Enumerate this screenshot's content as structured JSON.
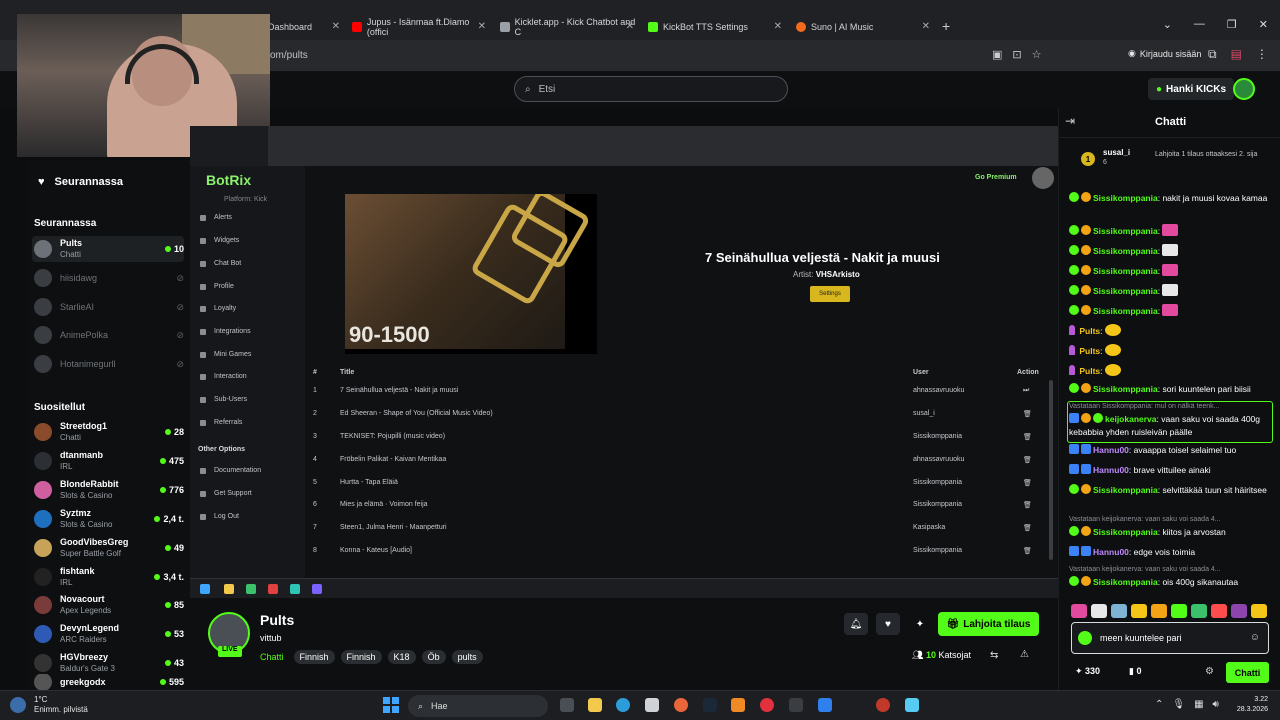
{
  "browser": {
    "tabs": [
      {
        "label": "Dashboard",
        "color": "#53fc18"
      },
      {
        "label": "Jupus - Isänmaa ft.Diamo (offici",
        "color": "#ff0000"
      },
      {
        "label": "Kicklet.app - Kick Chatbot and C",
        "color": "#9aa0a6"
      },
      {
        "label": "KickBot TTS Settings",
        "color": "#53fc18"
      },
      {
        "label": "Suno | AI Music",
        "color": "#f26b1d"
      }
    ],
    "url": "om/pults",
    "signin_label": "Kirjaudu sisään",
    "new_tab": "+"
  },
  "header": {
    "search_placeholder": "Etsi",
    "get_kicks": "Hanki KICKs"
  },
  "sidebar": {
    "following_label": "Seurannassa",
    "section_following": "Seurannassa",
    "following": [
      {
        "name": "Pults",
        "category": "Chatti",
        "count": "10",
        "live": true
      },
      {
        "name": "hiisidawg",
        "live": false
      },
      {
        "name": "StarlieAI",
        "live": false
      },
      {
        "name": "AnimePolka",
        "live": false
      },
      {
        "name": "Hotanimegurll",
        "live": false
      }
    ],
    "section_recommended": "Suositellut",
    "recommended": [
      {
        "name": "Streetdog1",
        "category": "Chatti",
        "count": "28"
      },
      {
        "name": "dtanmanb",
        "category": "IRL",
        "count": "475"
      },
      {
        "name": "BlondeRabbit",
        "category": "Slots & Casino",
        "count": "776"
      },
      {
        "name": "Syztmz",
        "category": "Slots & Casino",
        "count": "2,4 t."
      },
      {
        "name": "GoodVibesGreg",
        "category": "Super Battle Golf",
        "count": "49"
      },
      {
        "name": "fishtank",
        "category": "IRL",
        "count": "3,4 t."
      },
      {
        "name": "Novacourt",
        "category": "Apex Legends",
        "count": "85"
      },
      {
        "name": "DevynLegend",
        "category": "ARC Raiders",
        "count": "53"
      },
      {
        "name": "HGVbreezy",
        "category": "Baldur's Gate 3",
        "count": "43"
      },
      {
        "name": "greekgodx",
        "category": "",
        "count": "595"
      }
    ]
  },
  "stream": {
    "botrix": {
      "logo": "BotRix",
      "platform": "Platform: Kick",
      "nav": [
        "Alerts",
        "Widgets",
        "Chat Bot",
        "Profile",
        "Loyalty",
        "Integrations",
        "Mini Games",
        "Interaction",
        "Sub-Users",
        "Referrals"
      ],
      "other_options": "Other Options",
      "other_nav": [
        "Documentation",
        "Get Support",
        "Log Out"
      ],
      "premium": "Go Premium",
      "video_sign": "90-1500",
      "now_playing_title": "7 Seinähullua veljestä - Nakit ja muusi",
      "artist_label": "Artist:",
      "artist": "VHSArkisto",
      "settings_label": "Settings",
      "queue_headers": {
        "num": "#",
        "title": "Title",
        "user": "User",
        "action": "Action"
      },
      "queue": [
        {
          "num": "1",
          "title": "7 Seinähullua veljestä - Nakit ja muusi",
          "user": "ahnassavruuoku"
        },
        {
          "num": "2",
          "title": "Ed Sheeran - Shape of You (Official Music Video)",
          "user": "susal_i"
        },
        {
          "num": "3",
          "title": "TEKNISET: Pojupilli (music video)",
          "user": "Sissikomppania"
        },
        {
          "num": "4",
          "title": "Fröbelin Palikat - Kaivan Mentikaa",
          "user": "ahnassavruuoku"
        },
        {
          "num": "5",
          "title": "Hurtta - Tapa Eläiä",
          "user": "Sissikomppania"
        },
        {
          "num": "6",
          "title": "Mies ja elämä · Voimon feija",
          "user": "Sissikomppania"
        },
        {
          "num": "7",
          "title": "Steen1, Julma Henri - Maanpetturi",
          "user": "Kasipaska"
        },
        {
          "num": "8",
          "title": "Konna - Kateus [Audio]",
          "user": "Sissikomppania"
        }
      ]
    }
  },
  "channel": {
    "name": "Pults",
    "title": "vittub",
    "live": "LIVE",
    "category": "Chatti",
    "tags": [
      "Finnish",
      "Finnish",
      "K18",
      "Öb",
      "pults"
    ],
    "gift_sub": "Lahjoita tilaus",
    "viewers": "10",
    "viewers_label": "Katsojat"
  },
  "chat": {
    "title": "Chatti",
    "pinned": {
      "rank": "1",
      "user": "susal_i",
      "sub_count": "6",
      "text": "Lahjoita 1 tilaus ottaaksesi 2. sija"
    },
    "messages": [
      {
        "user": "Sissikomppania",
        "color": "#53fc18",
        "text": "nakit ja muusi kovaa kamaa",
        "badges": [
          "g",
          "o"
        ]
      },
      {
        "user": "Sissikomppania",
        "color": "#53fc18",
        "text": "",
        "emote": "#e24aa0",
        "badges": [
          "g",
          "o"
        ]
      },
      {
        "user": "Sissikomppania",
        "color": "#53fc18",
        "text": "",
        "emote": "#e8e8e8",
        "badges": [
          "g",
          "o"
        ]
      },
      {
        "user": "Sissikomppania",
        "color": "#53fc18",
        "text": "",
        "emote": "#e24aa0",
        "badges": [
          "g",
          "o"
        ]
      },
      {
        "user": "Sissikomppania",
        "color": "#53fc18",
        "text": "",
        "emote": "#e8e8e8",
        "badges": [
          "g",
          "o"
        ]
      },
      {
        "user": "Sissikomppania",
        "color": "#53fc18",
        "text": "",
        "emote": "#e24aa0",
        "badges": [
          "g",
          "o"
        ]
      },
      {
        "user": "Pults",
        "color": "#f5c518",
        "text": "",
        "emote": "#f5c518",
        "badges": [
          "p"
        ]
      },
      {
        "user": "Pults",
        "color": "#f5c518",
        "text": "",
        "emote": "#f5c518",
        "badges": [
          "p"
        ]
      },
      {
        "user": "Pults",
        "color": "#f5c518",
        "text": "",
        "emote": "#f5c518",
        "badges": [
          "p"
        ]
      },
      {
        "user": "Sissikomppania",
        "color": "#53fc18",
        "text": "sori kuuntelen pari biisii",
        "badges": [
          "g",
          "o"
        ]
      }
    ],
    "reply1_context": "Vastataan Sissikomppania: mul on nälkä teenk...",
    "reply1": {
      "user": "keijokanerva",
      "color": "#53fc18",
      "text": "vaan saku voi saada 400g kebabbia yhden ruisleivän päälle"
    },
    "hannu1": {
      "user": "Hannu00",
      "color": "#c08aff",
      "text": "avaappa toisel selaimel tuo"
    },
    "hannu2": {
      "user": "Hannu00",
      "color": "#c08aff",
      "text": "brave vittuilee ainaki"
    },
    "sissi_sel": {
      "user": "Sissikomppania",
      "color": "#53fc18",
      "text": "selvittäkää tuun sit häiritsee"
    },
    "reply2_context": "Vastataan keijokanerva: vaan saku voi saada 4...",
    "sissi_kiitos": {
      "user": "Sissikomppania",
      "color": "#53fc18",
      "text": "kiitos ja arvostan"
    },
    "hannu3": {
      "user": "Hannu00",
      "color": "#c08aff",
      "text": "edge vois toimia"
    },
    "reply3_context": "Vastataan keijokanerva: vaan saku voi saada 4...",
    "sissi_ois": {
      "user": "Sissikomppania",
      "color": "#53fc18",
      "text": "ois 400g sikanautaa"
    },
    "input_value": "meen kuuntelee pari",
    "kicks_count": "330",
    "gifts_count": "0",
    "send_label": "Chatti"
  },
  "taskbar": {
    "temp": "1°C",
    "weather": "Enimm. pilvistä",
    "search": "Hae",
    "time": "3.22",
    "date": "28.3.2026"
  }
}
